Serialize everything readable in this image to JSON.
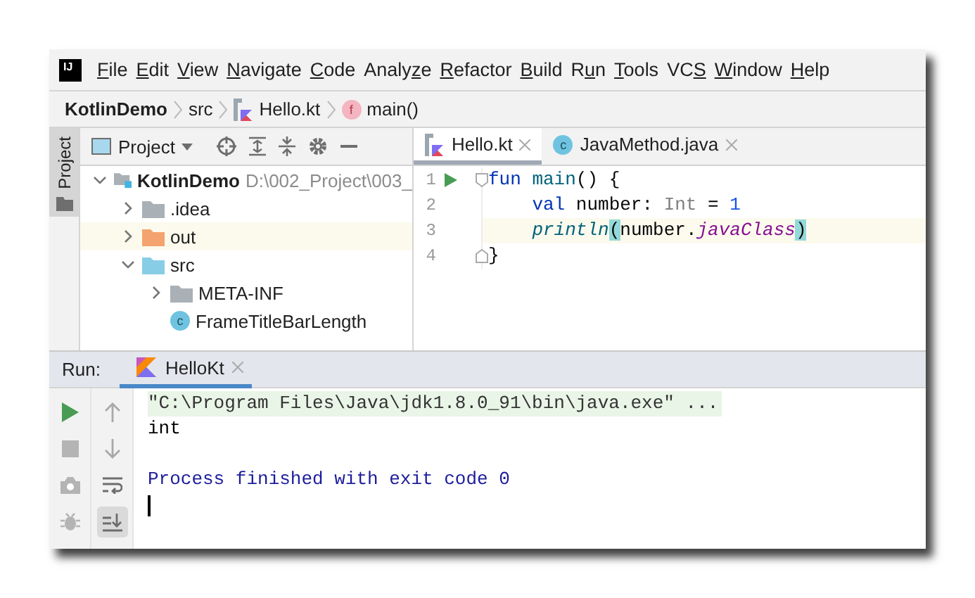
{
  "logo": "IJ",
  "menu": [
    {
      "key": "F",
      "rest": "ile"
    },
    {
      "key": "E",
      "rest": "dit"
    },
    {
      "key": "V",
      "rest": "iew"
    },
    {
      "key": "N",
      "rest": "avigate"
    },
    {
      "key": "C",
      "rest": "ode"
    },
    {
      "lead": "Analy",
      "key": "z",
      "rest": "e"
    },
    {
      "key": "R",
      "rest": "efactor"
    },
    {
      "key": "B",
      "rest": "uild"
    },
    {
      "lead": "R",
      "key": "u",
      "rest": "n"
    },
    {
      "key": "T",
      "rest": "ools"
    },
    {
      "lead": "VC",
      "key": "S"
    },
    {
      "key": "W",
      "rest": "indow"
    },
    {
      "key": "H",
      "rest": "elp"
    }
  ],
  "breadcrumbs": [
    {
      "label": "KotlinDemo",
      "kind": "project"
    },
    {
      "label": "src",
      "kind": "folder"
    },
    {
      "label": "Hello.kt",
      "kind": "kotlin"
    },
    {
      "label": "main()",
      "kind": "function",
      "badge": "f"
    }
  ],
  "tool_strip": {
    "label": "Project"
  },
  "project_panel": {
    "view": "Project",
    "tree": [
      {
        "label": "KotlinDemo",
        "path": "D:\\002_Project\\003_",
        "kind": "module",
        "expanded": true,
        "selected": false,
        "children": [
          {
            "label": ".idea",
            "kind": "folder",
            "color": "#a9b0b6",
            "expanded": false,
            "selected": false
          },
          {
            "label": "out",
            "kind": "folder",
            "color": "#f4a36e",
            "expanded": false,
            "selected": true
          },
          {
            "label": "src",
            "kind": "folder",
            "color": "#87cde6",
            "expanded": true,
            "selected": false,
            "children": [
              {
                "label": "META-INF",
                "kind": "folder",
                "color": "#a9b0b6",
                "expanded": false,
                "selected": false
              },
              {
                "label": "FrameTitleBarLength",
                "kind": "class",
                "badge": "c",
                "selected": false
              }
            ]
          }
        ]
      }
    ]
  },
  "editor": {
    "tabs": [
      {
        "label": "Hello.kt",
        "kind": "kotlin",
        "selected": true
      },
      {
        "label": "JavaMethod.java",
        "kind": "java",
        "badge": "c",
        "selected": false
      }
    ],
    "lines": [
      {
        "number": "1",
        "run": true,
        "fold": true,
        "current": false,
        "tokens": [
          {
            "text": "fun",
            "kind": "keyword"
          },
          {
            "text": " main",
            "kind": "function"
          },
          {
            "text": "() {",
            "kind": "plain"
          }
        ]
      },
      {
        "number": "2",
        "run": false,
        "fold": false,
        "current": false,
        "tokens": [
          {
            "text": "    val",
            "kind": "keyword"
          },
          {
            "text": " number: ",
            "kind": "plain"
          },
          {
            "text": "Int",
            "kind": "type"
          },
          {
            "text": " = ",
            "kind": "plain"
          },
          {
            "text": "1",
            "kind": "number"
          }
        ]
      },
      {
        "number": "3",
        "run": false,
        "fold": false,
        "current": true,
        "tokens": [
          {
            "text": "    println",
            "kind": "call"
          },
          {
            "text": "(",
            "kind": "match"
          },
          {
            "text": "number.",
            "kind": "plain"
          },
          {
            "text": "javaClass",
            "kind": "property"
          },
          {
            "text": ")",
            "kind": "match"
          }
        ]
      },
      {
        "number": "4",
        "run": false,
        "fold": true,
        "current": false,
        "tokens": [
          {
            "text": "}",
            "kind": "plain"
          }
        ]
      }
    ]
  },
  "run_panel": {
    "label": "Run:",
    "tabs": [
      {
        "label": "HelloKt",
        "selected": true
      }
    ],
    "left_tools": [
      {
        "kind": "rerun",
        "disabled": false
      },
      {
        "kind": "stop",
        "disabled": true
      },
      {
        "kind": "camera",
        "disabled": true
      },
      {
        "kind": "bug",
        "disabled": true
      }
    ],
    "right_tools": [
      {
        "kind": "up",
        "on": false
      },
      {
        "kind": "down",
        "on": false
      },
      {
        "kind": "wrap",
        "on": false
      },
      {
        "kind": "scroll_end",
        "on": true
      }
    ],
    "console": [
      {
        "kind": "command",
        "text": "\"C:\\Program Files\\Java\\jdk1.8.0_91\\bin\\java.exe\" ..."
      },
      {
        "kind": "output",
        "text": "int"
      },
      {
        "kind": "blank"
      },
      {
        "kind": "system",
        "text": "Process finished with exit code 0"
      },
      {
        "kind": "cursor"
      }
    ]
  }
}
